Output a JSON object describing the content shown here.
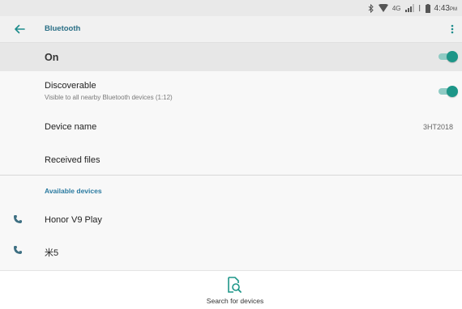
{
  "status_bar": {
    "network": "4G",
    "time": "4:43",
    "ampm": "PM"
  },
  "app_bar": {
    "title": "Bluetooth"
  },
  "bluetooth": {
    "toggle_label": "On",
    "enabled": true
  },
  "discoverable": {
    "title": "Discoverable",
    "subtitle": "Visible to all nearby Bluetooth devices (1:12)",
    "enabled": true
  },
  "device_name": {
    "label": "Device name",
    "value": "3HT2018"
  },
  "received_files": {
    "label": "Received files"
  },
  "available_devices": {
    "header": "Available devices",
    "items": [
      {
        "name": "Honor V9 Play",
        "icon": "phone-icon"
      },
      {
        "name": "米5",
        "icon": "phone-icon"
      }
    ]
  },
  "bottom_bar": {
    "search_label": "Search for devices",
    "search_icon": "search-device-icon"
  },
  "colors": {
    "accent": "#1d9688",
    "accent_track": "#8fcbc4",
    "title_blue": "#2a6f86",
    "section_blue": "#2a7aa0"
  }
}
